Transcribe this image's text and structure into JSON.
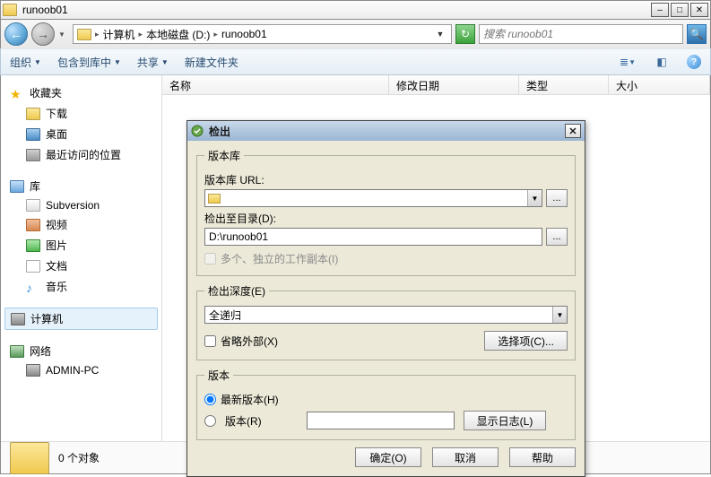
{
  "titlebar": {
    "title": "runoob01"
  },
  "win_btns": {
    "min": "–",
    "max": "□",
    "close": "✕"
  },
  "nav": {
    "back": "←",
    "forward": "→",
    "crumbs": [
      "计算机",
      "本地磁盘 (D:)",
      "runoob01"
    ]
  },
  "search": {
    "placeholder": "搜索 runoob01"
  },
  "toolbar": {
    "organize": "组织",
    "include": "包含到库中",
    "share": "共享",
    "new_folder": "新建文件夹"
  },
  "columns": {
    "name": "名称",
    "date": "修改日期",
    "type": "类型",
    "size": "大小"
  },
  "sidebar": {
    "favorites": {
      "label": "收藏夹",
      "items": [
        "下载",
        "桌面",
        "最近访问的位置"
      ]
    },
    "libraries": {
      "label": "库",
      "items": [
        "Subversion",
        "视频",
        "图片",
        "文档",
        "音乐"
      ]
    },
    "computer": "计算机",
    "network": {
      "label": "网络",
      "items": [
        "ADMIN-PC"
      ]
    }
  },
  "status": {
    "count": "0 个对象"
  },
  "dialog": {
    "title": "检出",
    "repo": {
      "legend": "版本库",
      "url_label": "版本库 URL:",
      "url_value": "",
      "dir_label": "检出至目录(D):",
      "dir_value": "D:\\runoob01",
      "multi_label": "多个、独立的工作副本(I)"
    },
    "depth": {
      "legend": "检出深度(E)",
      "value": "全递归",
      "omit_ext": "省略外部(X)",
      "select_items": "选择项(C)..."
    },
    "rev": {
      "legend": "版本",
      "head": "最新版本(H)",
      "rev": "版本(R)",
      "show_log": "显示日志(L)"
    },
    "buttons": {
      "ok": "确定(O)",
      "cancel": "取消",
      "help": "帮助"
    }
  }
}
